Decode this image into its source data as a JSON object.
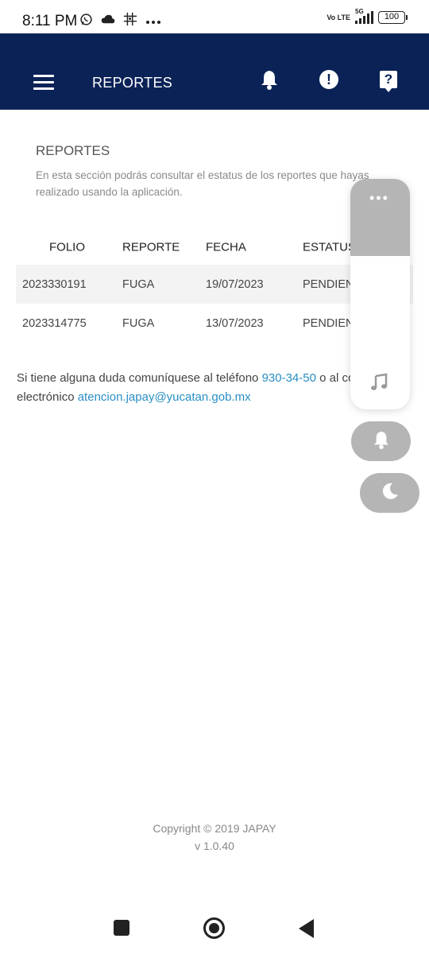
{
  "status_bar": {
    "time": "8:11 PM",
    "icons": [
      "whatsapp-icon",
      "cloud-icon",
      "grid-icon",
      "more-dots-icon"
    ],
    "volte": "Vo LTE",
    "network": "5G",
    "battery": "100"
  },
  "header": {
    "title": "REPORTES",
    "bg_color": "#0b2257",
    "icons": [
      "menu-icon",
      "bell-icon",
      "alert-icon",
      "help-icon"
    ]
  },
  "section": {
    "title": "REPORTES",
    "description": "En esta sección podrás consultar el estatus de los reportes que hayas realizado usando la aplicación."
  },
  "table": {
    "columns": [
      "FOLIO",
      "REPORTE",
      "FECHA",
      "ESTATUS"
    ],
    "rows": [
      [
        "2023330191",
        "FUGA",
        "19/07/2023",
        "PENDIENTE"
      ],
      [
        "2023314775",
        "FUGA",
        "13/07/2023",
        "PENDIENTE"
      ]
    ]
  },
  "contact": {
    "text1": "Si tiene alguna duda comuníquese al teléfono ",
    "phone": "930-34-50",
    "text2": " o al correo electrónico ",
    "email": "atencion.japay@yucatan.gob.mx"
  },
  "overlay": {
    "dots": "•••",
    "icons": [
      "music-note-icon",
      "bell-icon",
      "moon-icon"
    ]
  },
  "footer": {
    "copyright": "Copyright © 2019 JAPAY",
    "version": "v 1.0.40"
  },
  "accent_link_color": "#2a8fc4"
}
